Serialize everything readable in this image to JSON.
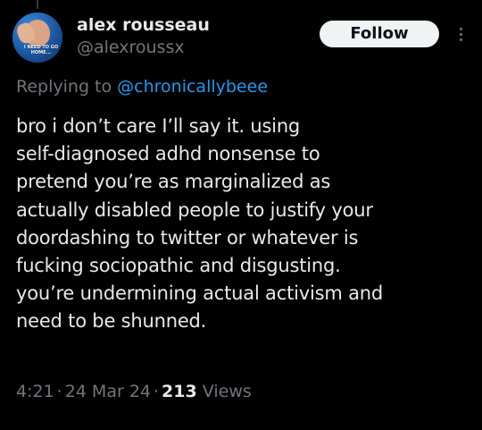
{
  "author": {
    "display_name": "alex rousseau",
    "handle": "@alexroussx",
    "avatar_caption": "I NEED TO GO HOME..."
  },
  "follow_label": "Follow",
  "more_icon": "more-vertical-icon",
  "reply": {
    "prefix": "Replying to ",
    "target": "@chronicallybeee"
  },
  "tweet_lines": [
    "bro i don’t care I’ll say it. using",
    "self-diagnosed adhd nonsense to",
    "pretend you’re as marginalized as",
    "actually disabled people to justify your",
    "doordashing to twitter or whatever is",
    "fucking sociopathic and disgusting.",
    "you’re undermining actual activism and",
    "need to be shunned."
  ],
  "meta": {
    "time": "4:21",
    "separator": "·",
    "date": "24 Mar 24",
    "views_count": "213",
    "views_label": "Views"
  },
  "colors": {
    "background": "#000000",
    "text_primary": "#e7e9ea",
    "text_secondary": "#71767b",
    "link": "#1d9bf0",
    "button_bg": "#eff3f4",
    "button_text": "#0f1419"
  }
}
